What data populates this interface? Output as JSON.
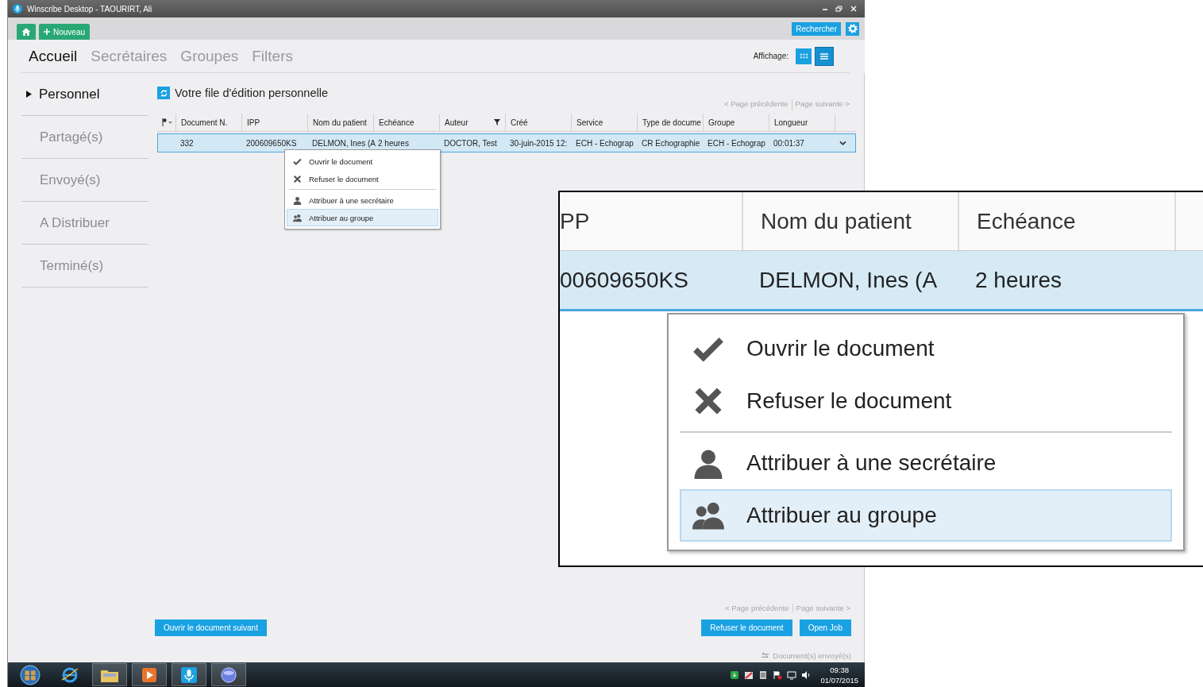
{
  "window": {
    "title": "Winscribe Desktop - TAOURIRT, Ali"
  },
  "toolbar": {
    "new_button": "Nouveau",
    "search_button": "Rechercher"
  },
  "nav_tabs": [
    {
      "label": "Accueil",
      "selected": true
    },
    {
      "label": "Secrétaires",
      "selected": false
    },
    {
      "label": "Groupes",
      "selected": false
    },
    {
      "label": "Filters",
      "selected": false
    }
  ],
  "display": {
    "label": "Affichage:",
    "views": [
      {
        "kind": "grid",
        "selected": false
      },
      {
        "kind": "list",
        "selected": true
      }
    ]
  },
  "sidebar": {
    "items": [
      {
        "label": "Personnel",
        "selected": true
      },
      {
        "label": "Partagé(s)",
        "selected": false
      },
      {
        "label": "Envoyé(s)",
        "selected": false
      },
      {
        "label": "A Distribuer",
        "selected": false
      },
      {
        "label": "Terminé(s)",
        "selected": false
      }
    ]
  },
  "queue": {
    "title": "Votre file d'édition personnelle",
    "pager": {
      "previous": "< Page précédente",
      "next": "Page suivante >"
    }
  },
  "table": {
    "columns": [
      {
        "label": "Document N."
      },
      {
        "label": "IPP"
      },
      {
        "label": "Nom du patient"
      },
      {
        "label": "Echéance"
      },
      {
        "label": "Auteur",
        "filter": true
      },
      {
        "label": "Créé"
      },
      {
        "label": "Service"
      },
      {
        "label": "Type de docume"
      },
      {
        "label": "Groupe"
      },
      {
        "label": "Longueur"
      }
    ],
    "rows": [
      {
        "selected": true,
        "cells": [
          "332",
          "200609650KS",
          "DELMON, Ines (A",
          "2 heures",
          "DOCTOR, Test",
          "30-juin-2015 12:",
          "ECH - Echograp",
          "CR Echographie",
          "ECH - Echograp",
          "00:01:37"
        ]
      }
    ]
  },
  "context_menu": {
    "items": [
      {
        "label": "Ouvrir le document",
        "separator_before": false,
        "selected": false
      },
      {
        "label": "Refuser le document",
        "separator_before": false,
        "selected": false
      },
      {
        "label": "Attribuer à une secrétaire",
        "separator_before": true,
        "selected": false
      },
      {
        "label": "Attribuer au groupe",
        "separator_before": false,
        "selected": true
      }
    ]
  },
  "footer": {
    "pager": {
      "previous": "< Page précédente",
      "next": "Page suivante >"
    },
    "left_buttons": [
      "Ouvrir le document suivant"
    ],
    "right_buttons": [
      "Refuser le document",
      "Open Job"
    ],
    "status": "Document(s) envoyé(s)"
  },
  "taskbar": {
    "time": "09:38",
    "date": "01/07/2015"
  },
  "zoom_inset": {
    "columns": [
      "PP",
      "Nom du patient",
      "Echéance"
    ],
    "row": {
      "selected": true,
      "cells": [
        "00609650KS",
        "DELMON, Ines (A",
        "2 heures"
      ]
    },
    "menu": [
      {
        "label": "Ouvrir le document",
        "separator_before": false,
        "selected": false
      },
      {
        "label": "Refuser le document",
        "separator_before": false,
        "selected": false
      },
      {
        "label": "Attribuer à une secrétaire",
        "separator_before": true,
        "selected": false
      },
      {
        "label": "Attribuer au groupe",
        "separator_before": false,
        "selected": true
      }
    ]
  }
}
